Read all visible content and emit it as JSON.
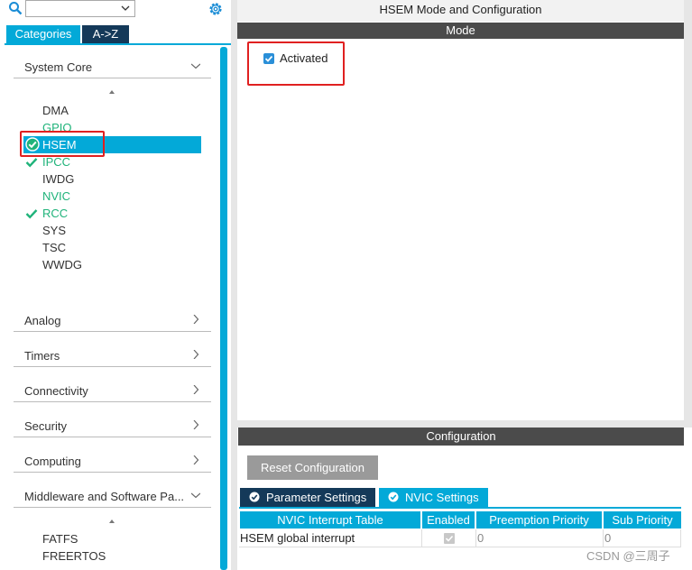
{
  "sidebar": {
    "search_value": "",
    "tabs": [
      "Categories",
      "A->Z"
    ],
    "sections_top": {
      "system_core": "System Core"
    },
    "system_core_items": [
      {
        "label": "DMA",
        "state": "normal"
      },
      {
        "label": "GPIO",
        "state": "green"
      },
      {
        "label": "HSEM",
        "state": "selected-checked"
      },
      {
        "label": "IPCC",
        "state": "green-checked"
      },
      {
        "label": "IWDG",
        "state": "normal"
      },
      {
        "label": "NVIC",
        "state": "green"
      },
      {
        "label": "RCC",
        "state": "green-checked"
      },
      {
        "label": "SYS",
        "state": "normal"
      },
      {
        "label": "TSC",
        "state": "normal"
      },
      {
        "label": "WWDG",
        "state": "normal"
      }
    ],
    "sections": [
      "Analog",
      "Timers",
      "Connectivity",
      "Security",
      "Computing",
      "Middleware and Software Pa..."
    ],
    "middleware_items": [
      "FATFS",
      "FREERTOS"
    ]
  },
  "main": {
    "title": "HSEM Mode and Configuration",
    "mode_header": "Mode",
    "activated_label": "Activated",
    "activated_checked": true,
    "config_header": "Configuration",
    "reset_button": "Reset Configuration",
    "tabs": [
      "Parameter Settings",
      "NVIC Settings"
    ],
    "table": {
      "headers": [
        "NVIC Interrupt Table",
        "Enabled",
        "Preemption Priority",
        "Sub Priority"
      ],
      "rows": [
        {
          "name": "HSEM global interrupt",
          "enabled": true,
          "preemption": "0",
          "sub": "0"
        }
      ]
    }
  },
  "watermark": "CSDN @三周子",
  "colors": {
    "accent": "#03a9d8",
    "dark_tab": "#143959",
    "green": "#1fb37a",
    "highlight": "#e02020",
    "bar": "#4b4b4b"
  }
}
